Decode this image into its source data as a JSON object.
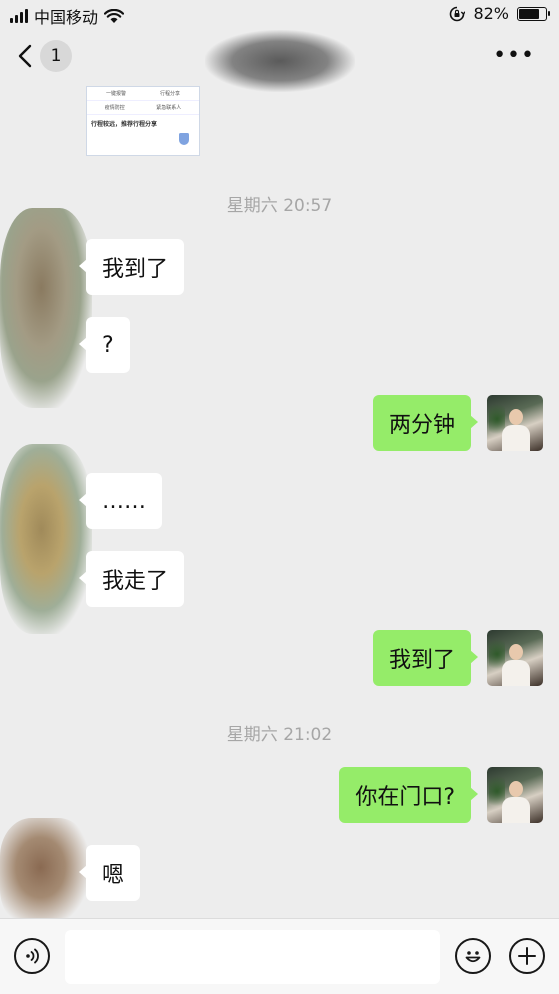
{
  "status_bar": {
    "carrier": "中国移动",
    "battery_percent": "82%",
    "battery_level": 0.82,
    "icons": [
      "signal-icon",
      "wifi-icon",
      "orientation-lock-icon",
      "battery-icon"
    ]
  },
  "nav": {
    "unread_count": "1",
    "more_label": "•••",
    "icons": [
      "back-chevron-icon",
      "more-icon"
    ]
  },
  "shared_card": {
    "menu_items": [
      "一键报警",
      "行程分享",
      "疫情防控",
      "紧急联系人"
    ],
    "title": "行程较远，推荐行程分享"
  },
  "messages": [
    {
      "type": "time",
      "text": "星期六 20:57"
    },
    {
      "type": "msg",
      "side": "left",
      "text": "我到了"
    },
    {
      "type": "msg",
      "side": "left",
      "text": "?"
    },
    {
      "type": "msg",
      "side": "right",
      "text": "两分钟"
    },
    {
      "type": "msg",
      "side": "left",
      "text": "……"
    },
    {
      "type": "msg",
      "side": "left",
      "text": "我走了"
    },
    {
      "type": "msg",
      "side": "right",
      "text": "我到了"
    },
    {
      "type": "time",
      "text": "星期六 21:02"
    },
    {
      "type": "msg",
      "side": "right",
      "text": "你在门口?"
    },
    {
      "type": "msg",
      "side": "left",
      "text": "嗯"
    }
  ],
  "input_bar": {
    "value": "",
    "icons": [
      "voice-icon",
      "emoji-icon",
      "plus-icon"
    ]
  },
  "colors": {
    "background": "#ededed",
    "my_bubble": "#95ec69",
    "their_bubble": "#ffffff",
    "timestamp": "#a6a6a6"
  }
}
